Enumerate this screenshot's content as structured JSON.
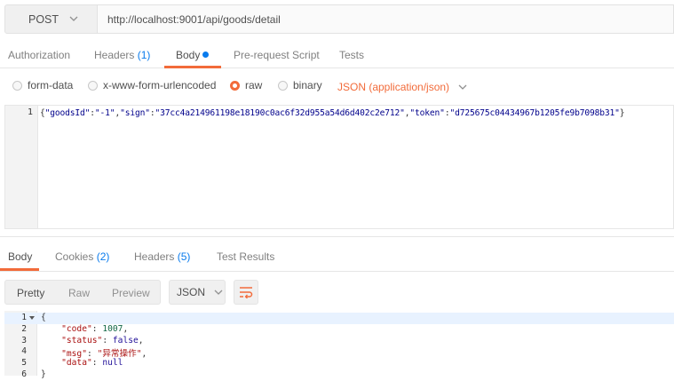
{
  "request": {
    "method": "POST",
    "url": "http://localhost:9001/api/goods/detail"
  },
  "req_tabs": [
    {
      "label": "Authorization",
      "count": ""
    },
    {
      "label": "Headers",
      "count": "(1)"
    },
    {
      "label": "Body",
      "count": ""
    },
    {
      "label": "Pre-request Script",
      "count": ""
    },
    {
      "label": "Tests",
      "count": ""
    }
  ],
  "active_req_tab": "Body",
  "body_types": [
    "form-data",
    "x-www-form-urlencoded",
    "raw",
    "binary"
  ],
  "selected_body_type": "raw",
  "content_type": "JSON (application/json)",
  "request_body": {
    "line_number": "1",
    "goodsId_key": "\"goodsId\"",
    "goodsId_val": "\"-1\"",
    "sign_key": "\"sign\"",
    "sign_val": "\"37cc4a214961198e18190c0ac6f32d955a54d6d402c2e712\"",
    "token_key": "\"token\"",
    "token_val": "\"d725675c04434967b1205fe9b7098b31\""
  },
  "res_tabs": [
    {
      "label": "Body",
      "count": ""
    },
    {
      "label": "Cookies",
      "count": "(2)"
    },
    {
      "label": "Headers",
      "count": "(5)"
    },
    {
      "label": "Test Results",
      "count": ""
    }
  ],
  "active_res_tab": "Body",
  "view_modes": [
    "Pretty",
    "Raw",
    "Preview"
  ],
  "selected_view_mode": "Pretty",
  "response_format": "JSON",
  "response_lines": [
    {
      "n": "1",
      "text": "{"
    },
    {
      "n": "2",
      "key": "\"code\"",
      "val": "1007",
      "tail": ","
    },
    {
      "n": "3",
      "key": "\"status\"",
      "val": "false",
      "tail": ","
    },
    {
      "n": "4",
      "key": "\"msg\"",
      "val": "\"异常操作\"",
      "tail": ","
    },
    {
      "n": "5",
      "key": "\"data\"",
      "val": "null",
      "tail": ""
    },
    {
      "n": "6",
      "text": "}"
    }
  ],
  "colors": {
    "accent": "#f26b3a",
    "link": "#097bed"
  }
}
